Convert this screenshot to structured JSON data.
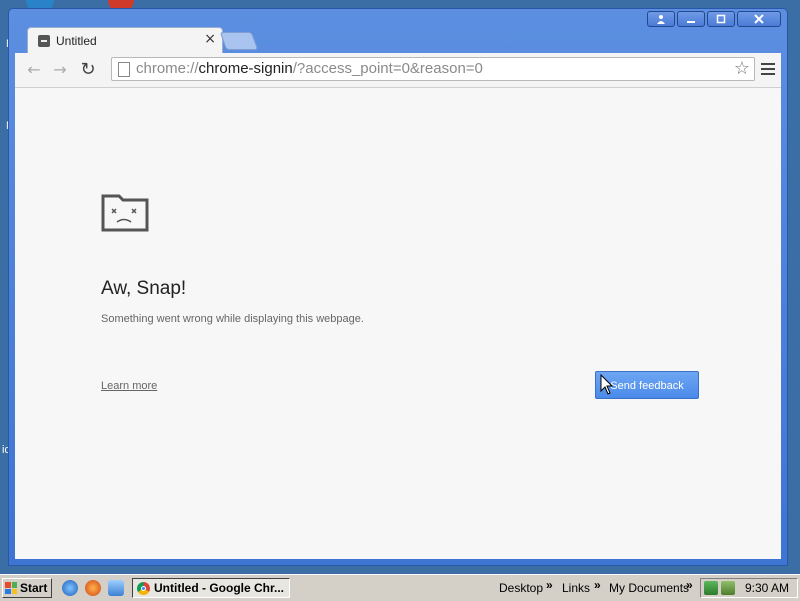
{
  "desktop": {
    "fragments": [
      "N",
      "N",
      "id"
    ]
  },
  "browser": {
    "tab": {
      "title": "Untitled",
      "close_icon": "×"
    },
    "window_controls": {
      "user": "user-icon",
      "minimize": "minimize-icon",
      "maximize": "maximize-icon",
      "close": "close-icon"
    },
    "toolbar": {
      "back_icon": "←",
      "forward_icon": "→",
      "reload_icon": "↻",
      "url_scheme": "chrome://",
      "url_host": "chrome-signin",
      "url_rest": "/?access_point=0&reason=0",
      "star_icon": "☆"
    },
    "content": {
      "title": "Aw, Snap!",
      "description": "Something went wrong while displaying this webpage.",
      "learn_more": "Learn more",
      "send_feedback": "Send feedback"
    }
  },
  "taskbar": {
    "start_label": "Start",
    "task_label": "Untitled - Google Chr...",
    "links": [
      "Desktop",
      "Links",
      "My Documents"
    ],
    "chevron": "»",
    "clock": "9:30 AM"
  },
  "colors": {
    "desktop": "#3a6ea5",
    "titlebar": "#4a7ed8",
    "feedback_button": "#4b8aea"
  }
}
